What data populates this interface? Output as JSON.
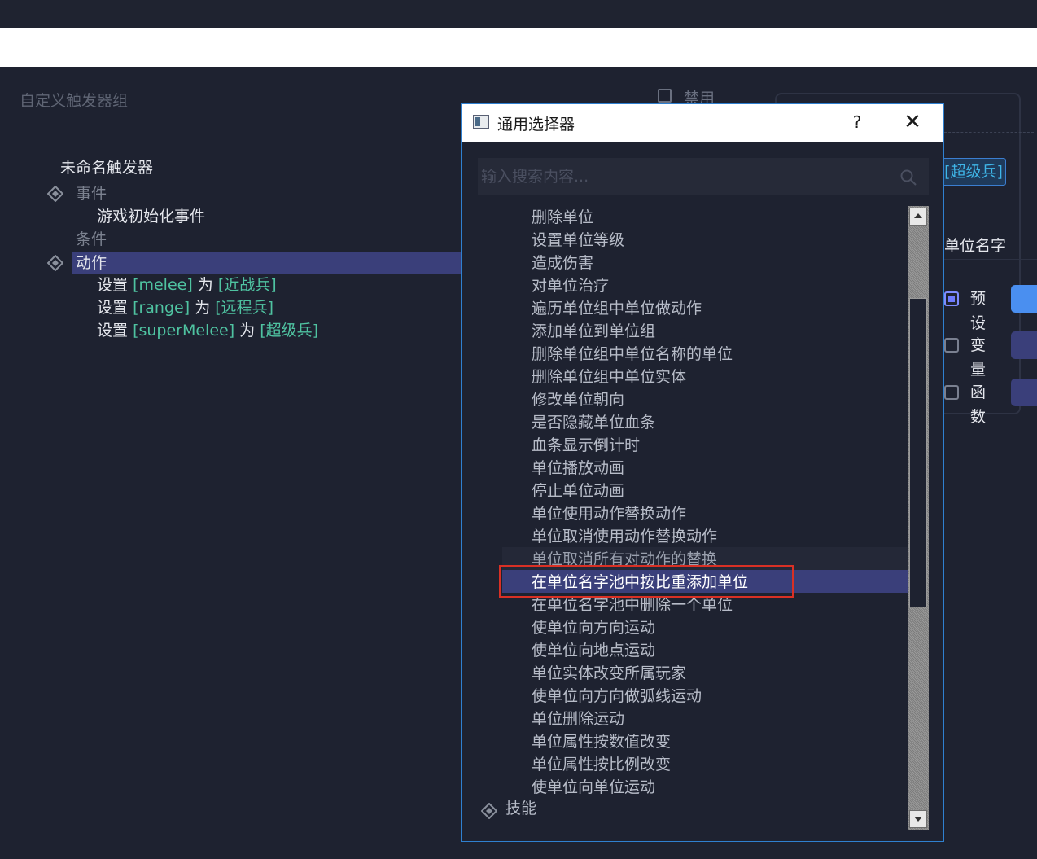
{
  "trigger_group": {
    "title": "自定义触发器组",
    "disable_label": "禁用"
  },
  "tree": {
    "trigger_name": "未命名触发器",
    "events_label": "事件",
    "event_item": "游戏初始化事件",
    "conditions_label": "条件",
    "actions_label": "动作",
    "actions": [
      {
        "prefix": "设置",
        "var": "[melee]",
        "mid": "为",
        "value": "[近战兵]"
      },
      {
        "prefix": "设置",
        "var": "[range]",
        "mid": "为",
        "value": "[远程兵]"
      },
      {
        "prefix": "设置",
        "var": "[superMelee]",
        "mid": "为",
        "value": "[超级兵]"
      }
    ]
  },
  "right_panel": {
    "tag": "[超级兵]",
    "field_label": "单位名字",
    "options": [
      {
        "label": "预设",
        "checked": true
      },
      {
        "label": "变量",
        "checked": false
      },
      {
        "label": "函数",
        "checked": false
      }
    ]
  },
  "dialog": {
    "title": "通用选择器",
    "help": "?",
    "close": "✕",
    "search_placeholder": "输入搜索内容...",
    "items": [
      "删除单位",
      "设置单位等级",
      "造成伤害",
      "对单位治疗",
      "遍历单位组中单位做动作",
      "添加单位到单位组",
      "删除单位组中单位名称的单位",
      "删除单位组中单位实体",
      "修改单位朝向",
      "是否隐藏单位血条",
      "血条显示倒计时",
      "单位播放动画",
      "停止单位动画",
      "单位使用动作替换动作",
      "单位取消使用动作替换动作",
      "单位取消所有对动作的替换",
      "在单位名字池中按比重添加单位",
      "在单位名字池中删除一个单位",
      "使单位向方向运动",
      "使单位向地点运动",
      "单位实体改变所属玩家",
      "使单位向方向做弧线运动",
      "单位删除运动",
      "单位属性按数值改变",
      "单位属性按比例改变",
      "使单位向单位运动"
    ],
    "selected_index": 16,
    "next_category": "技能"
  },
  "colors": {
    "accent": "#3a3f7a",
    "highlight_border": "#d93025",
    "variable_green": "#4fc3a1",
    "tag_blue": "#3fb6e8"
  }
}
